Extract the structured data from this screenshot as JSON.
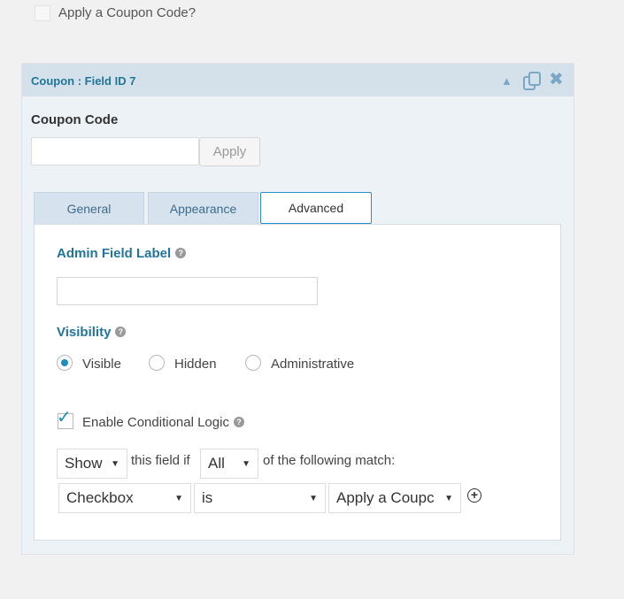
{
  "top": {
    "checkbox_label": "Apply a Coupon Code?"
  },
  "panel": {
    "title": "Coupon : Field ID 7",
    "icons": [
      "collapse-arrow-icon",
      "duplicate-icon",
      "close-icon"
    ],
    "coupon_code_label": "Coupon Code",
    "coupon_input_value": "",
    "apply_label": "Apply"
  },
  "tabs": [
    {
      "label": "General",
      "active": false
    },
    {
      "label": "Appearance",
      "active": false
    },
    {
      "label": "Advanced",
      "active": true
    }
  ],
  "advanced": {
    "admin_label": "Admin Field Label",
    "admin_value": "",
    "visibility_label": "Visibility",
    "visibility_options": [
      {
        "label": "Visible",
        "selected": true
      },
      {
        "label": "Hidden",
        "selected": false
      },
      {
        "label": "Administrative",
        "selected": false
      }
    ],
    "conditional_label": "Enable Conditional Logic",
    "conditional_checked": true,
    "logic": {
      "action": "Show",
      "mid_text": "this field if",
      "quantifier": "All",
      "end_text": "of the following match:"
    },
    "rule": {
      "field": "Checkbox",
      "operator": "is",
      "value": "Apply a Coupc"
    }
  },
  "colors": {
    "accent": "#21759b",
    "header_bg": "#d5e1ea",
    "check": "#1e8cbe"
  }
}
